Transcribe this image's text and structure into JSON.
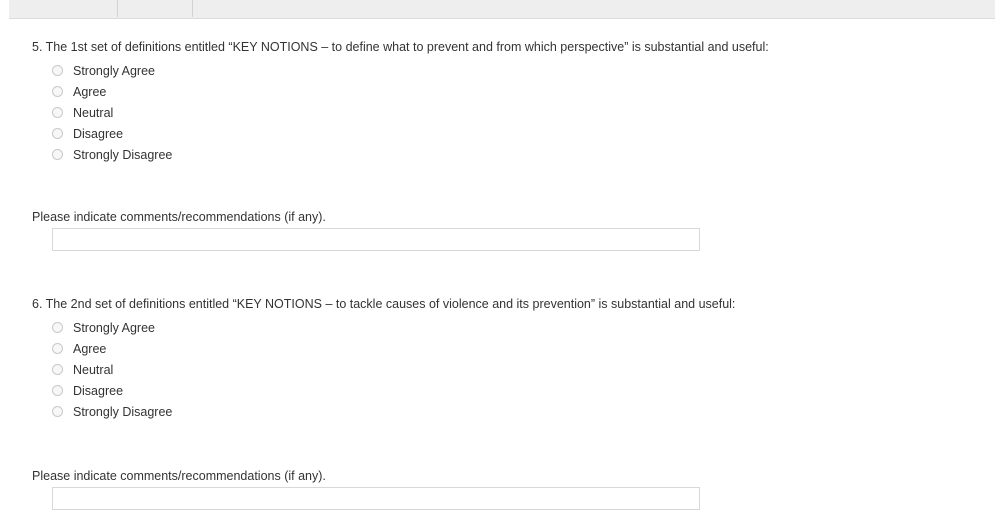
{
  "questions": [
    {
      "text": "5. The 1st set of definitions entitled “KEY NOTIONS – to define what to prevent and from which perspective” is substantial and useful:",
      "options": [
        "Strongly Agree",
        "Agree",
        "Neutral",
        "Disagree",
        "Strongly Disagree"
      ],
      "comment_label": "Please indicate comments/recommendations (if any).",
      "comment_value": ""
    },
    {
      "text": "6. The 2nd set of definitions entitled “KEY NOTIONS – to tackle causes of violence and its prevention” is substantial and useful:",
      "options": [
        "Strongly Agree",
        "Agree",
        "Neutral",
        "Disagree",
        "Strongly Disagree"
      ],
      "comment_label": "Please indicate comments/recommendations (if any).",
      "comment_value": ""
    }
  ],
  "colors": {
    "text": "#333333",
    "radio_border": "#c9c9c9",
    "input_border": "#d8d8d8",
    "top_bar": "#eeeeee"
  }
}
